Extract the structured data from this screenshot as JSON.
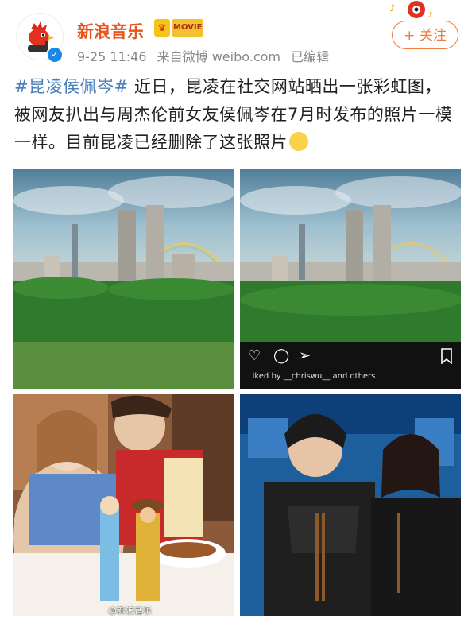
{
  "account": {
    "name": "新浪音乐",
    "badge_movie": "MOVIE",
    "time": "9-25 11:46",
    "source": "来自微博 weibo.com",
    "edited": "已编辑",
    "follow_label": "+ 关注"
  },
  "post": {
    "hashtag": "#昆凌侯佩岑#",
    "text": " 近日，昆凌在社交网站晒出一张彩虹图，被网友扒出与周杰伦前女友侯佩岑在7月时发布的照片一模一样。目前昆凌已经删除了这张照片"
  },
  "images": {
    "ig_likes_text": "Liked by __chriswu__ and others",
    "watermark": "@新浪音乐"
  },
  "colors": {
    "brand_orange": "#e8541c",
    "link_blue": "#4a80b9",
    "follow_orange": "#f07b3f"
  },
  "icons": [
    "avatar-bird-logo",
    "verified-icon",
    "vip-badge-icon",
    "heart-icon",
    "comment-icon",
    "send-icon",
    "bookmark-icon",
    "emoji-icon"
  ]
}
